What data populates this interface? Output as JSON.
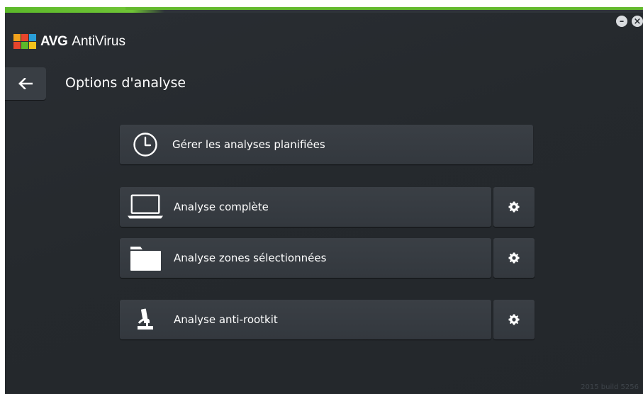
{
  "app": {
    "brand": "AVG",
    "product": "AntiVirus",
    "logo_icon": "avg-logo-icon",
    "minimize_icon": "minimize-icon",
    "close_icon": "close-icon"
  },
  "header": {
    "back_icon": "arrow-left-icon",
    "title": "Options d'analyse"
  },
  "scan_options": [
    {
      "label": "Gérer les analyses planifiées",
      "icon": "clock-icon",
      "has_settings": false
    },
    {
      "label": "Analyse complète",
      "icon": "laptop-icon",
      "has_settings": true,
      "settings_icon": "gear-icon"
    },
    {
      "label": "Analyse zones sélectionnées",
      "icon": "folder-icon",
      "has_settings": true,
      "settings_icon": "gear-icon"
    },
    {
      "label": "Analyse anti-rootkit",
      "icon": "microscope-icon",
      "has_settings": true,
      "settings_icon": "gear-icon"
    }
  ],
  "footer": {
    "version": "2015  build 5256"
  },
  "colors": {
    "background": "#25292d",
    "button": "#373c42",
    "accent_green": "#64b92e",
    "text": "#ffffff"
  }
}
